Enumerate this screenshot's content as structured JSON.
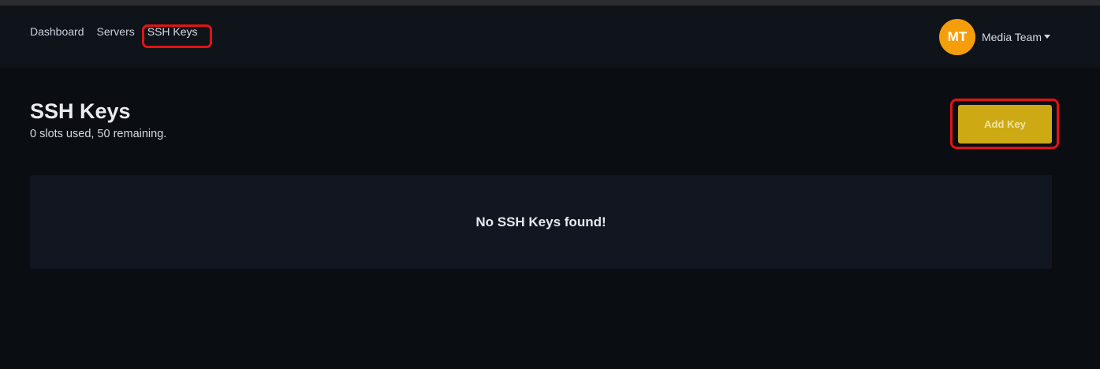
{
  "nav": {
    "links": [
      {
        "label": "Dashboard"
      },
      {
        "label": "Servers"
      },
      {
        "label": "SSH Keys",
        "active": true
      }
    ]
  },
  "user": {
    "initials": "MT",
    "name": "Media Team",
    "avatar_color": "#f59e0b"
  },
  "page": {
    "title": "SSH Keys",
    "subtitle": "0 slots used, 50 remaining.",
    "add_button_label": "Add Key",
    "empty_message": "No SSH Keys found!"
  },
  "colors": {
    "background": "#0a0d12",
    "navbar": "#0f131a",
    "panel": "#111620",
    "accent_button": "#cdaa13",
    "highlight_outline": "#e01414"
  }
}
